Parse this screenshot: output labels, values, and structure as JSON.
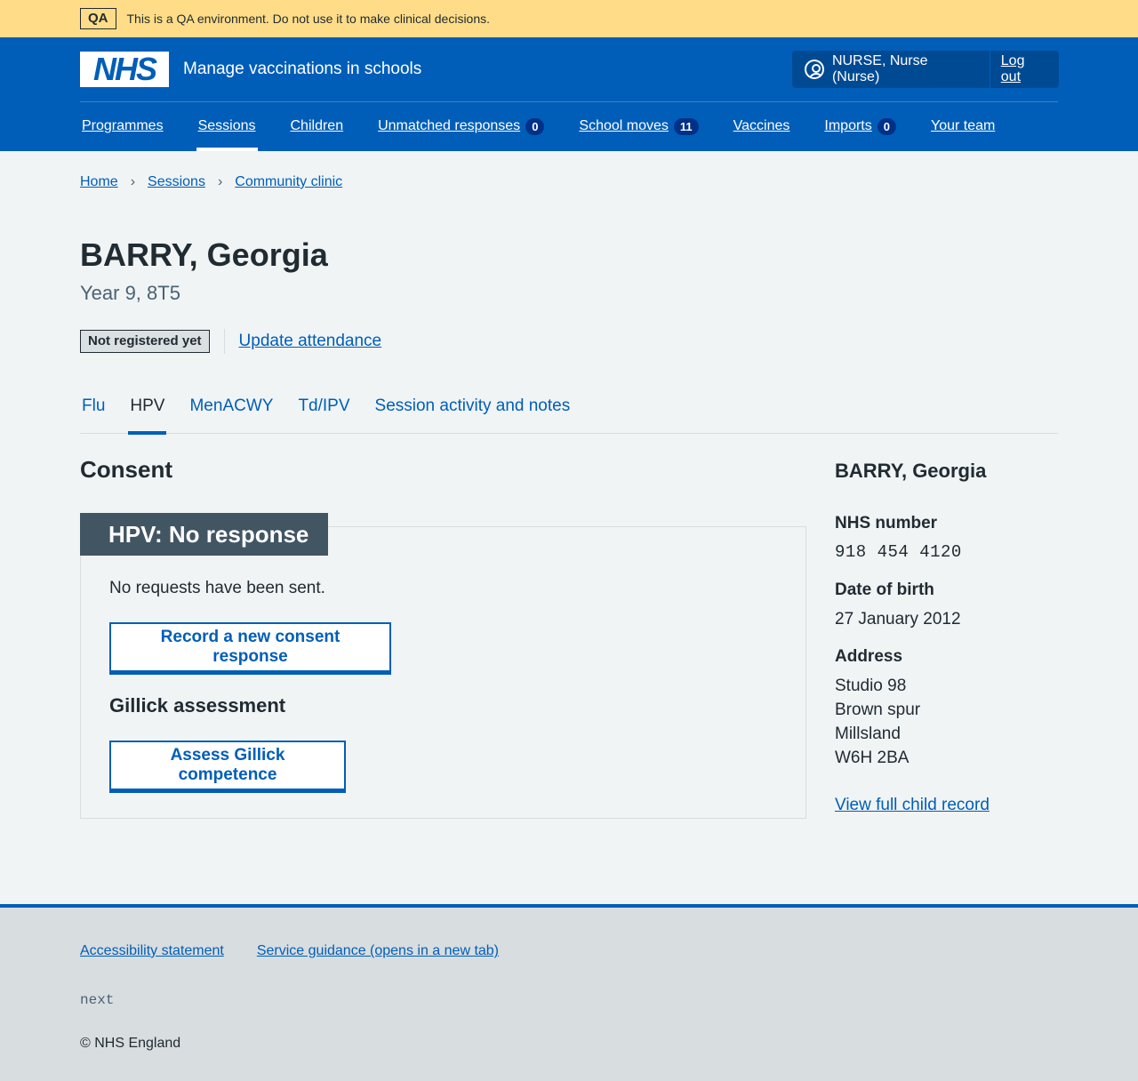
{
  "qa_banner": {
    "tag": "QA",
    "text": "This is a QA environment. Do not use it to make clinical decisions."
  },
  "header": {
    "logo_text": "NHS",
    "service_name": "Manage vaccinations in schools",
    "account_name": "NURSE, Nurse (Nurse)",
    "logout_label": "Log out"
  },
  "nav": {
    "programmes": "Programmes",
    "sessions": "Sessions",
    "children": "Children",
    "unmatched": "Unmatched responses",
    "unmatched_count": "0",
    "school_moves": "School moves",
    "school_moves_count": "11",
    "vaccines": "Vaccines",
    "imports": "Imports",
    "imports_count": "0",
    "your_team": "Your team"
  },
  "breadcrumb": {
    "home": "Home",
    "sessions": "Sessions",
    "session": "Community clinic"
  },
  "patient": {
    "name": "BARRY, Georgia",
    "subtitle": "Year 9, 8T5",
    "registration_status": "Not registered yet",
    "update_attendance": "Update attendance"
  },
  "tabs": {
    "flu": "Flu",
    "hpv": "HPV",
    "menacwy": "MenACWY",
    "tdipv": "Td/IPV",
    "activity": "Session activity and notes"
  },
  "consent": {
    "heading": "Consent",
    "card_title": "HPV: No response",
    "no_requests": "No requests have been sent.",
    "record_button": "Record a new consent response",
    "gillick_heading": "Gillick assessment",
    "gillick_button": "Assess Gillick competence"
  },
  "summary": {
    "name": "BARRY, Georgia",
    "nhs_number_label": "NHS number",
    "nhs_number": "918 454 4120",
    "dob_label": "Date of birth",
    "dob": "27 January 2012",
    "address_label": "Address",
    "address_line1": "Studio 98",
    "address_line2": "Brown spur",
    "address_line3": "Millsland",
    "address_line4": "W6H 2BA",
    "full_record_link": "View full child record"
  },
  "footer": {
    "accessibility": "Accessibility statement",
    "guidance": "Service guidance (opens in a new tab)",
    "version": "next",
    "copyright": "© NHS England"
  }
}
